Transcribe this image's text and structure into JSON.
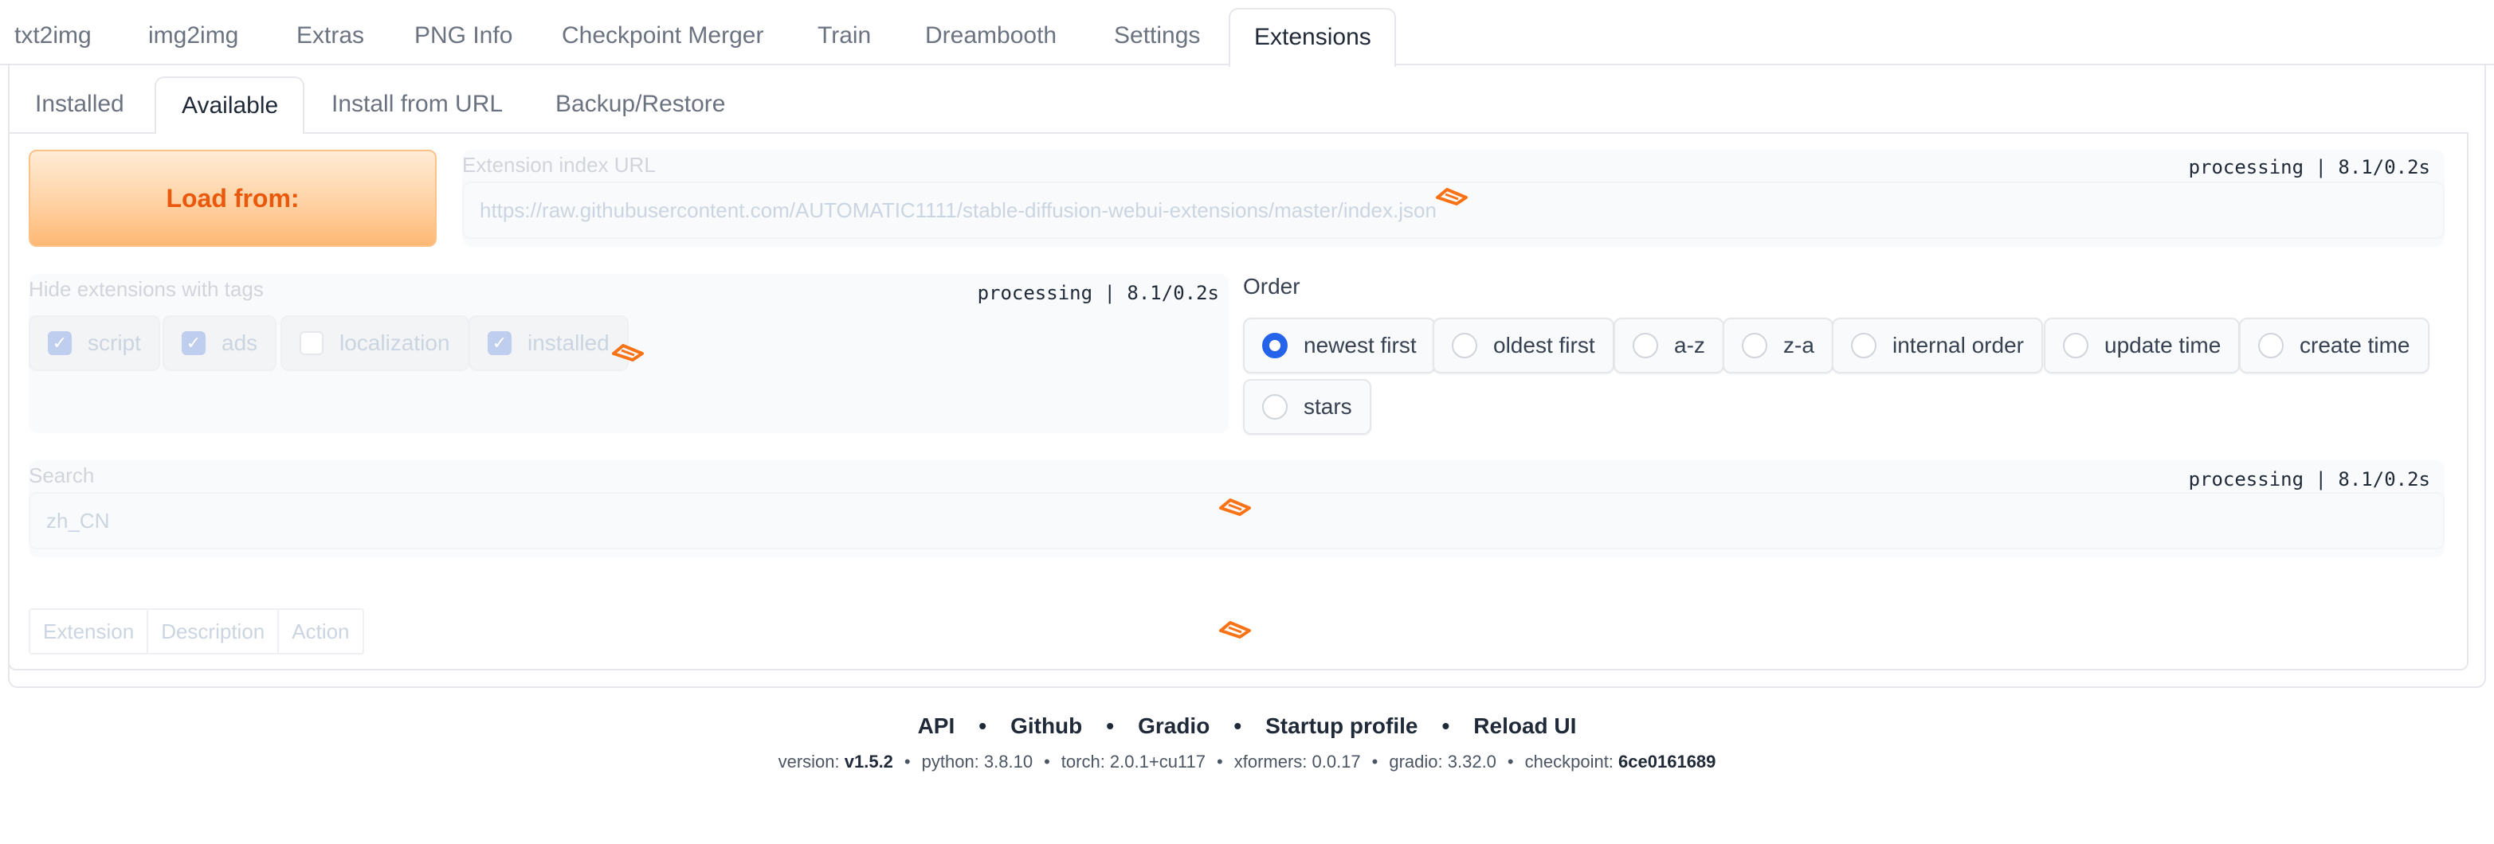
{
  "top_tabs": [
    "txt2img",
    "img2img",
    "Extras",
    "PNG Info",
    "Checkpoint Merger",
    "Train",
    "Dreambooth",
    "Settings",
    "Extensions"
  ],
  "sub_tabs": [
    "Installed",
    "Available",
    "Install from URL",
    "Backup/Restore"
  ],
  "load_button": "Load from:",
  "index_url": {
    "label": "Extension index URL",
    "value": "https://raw.githubusercontent.com/AUTOMATIC1111/stable-diffusion-webui-extensions/master/index.json",
    "status": "processing | 8.1/0.2s"
  },
  "hide_tags": {
    "label": "Hide extensions with tags",
    "status": "processing | 8.1/0.2s",
    "options": [
      {
        "label": "script",
        "checked": true
      },
      {
        "label": "ads",
        "checked": true
      },
      {
        "label": "localization",
        "checked": false
      },
      {
        "label": "installed",
        "checked": true
      }
    ]
  },
  "order": {
    "label": "Order",
    "options": [
      "newest first",
      "oldest first",
      "a-z",
      "z-a",
      "internal order",
      "update time",
      "create time",
      "stars"
    ],
    "selected": "newest first"
  },
  "search": {
    "label": "Search",
    "value": "zh_CN",
    "status": "processing | 8.1/0.2s"
  },
  "table": {
    "headers": [
      "Extension",
      "Description",
      "Action"
    ]
  },
  "footer": {
    "links": [
      "API",
      "Github",
      "Gradio",
      "Startup profile",
      "Reload UI"
    ],
    "separator": "•",
    "version_label": "version:",
    "version": "v1.5.2",
    "python": "python: 3.8.10",
    "torch": "torch: 2.0.1+cu117",
    "xformers": "xformers: 0.0.17",
    "gradio": "gradio: 3.32.0",
    "checkpoint_label": "checkpoint:",
    "checkpoint": "6ce0161689"
  },
  "colors": {
    "accent": "#ea580c",
    "radio_selected": "#2563eb",
    "spinner": "#f97316"
  }
}
